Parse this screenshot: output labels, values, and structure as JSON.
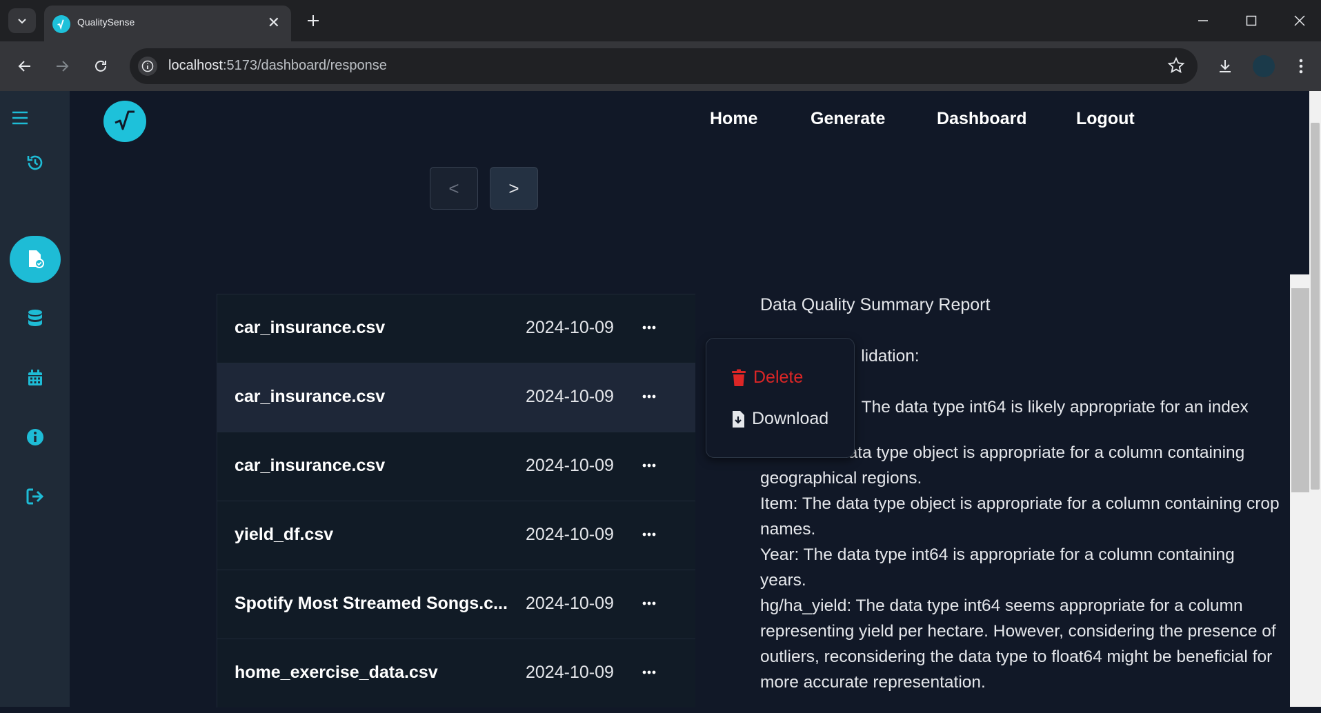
{
  "browser": {
    "tab_title": "QualitySense",
    "url_host": "localhost",
    "url_path": ":5173/dashboard/response"
  },
  "icons": {
    "tab_menu": "chevron-down-icon",
    "favicon": "qualitysense-logo",
    "tab_close": "close-icon",
    "new_tab": "plus-icon",
    "back": "arrow-left-icon",
    "forward": "arrow-right-icon",
    "reload": "reload-icon",
    "site_info": "info-icon",
    "bookmark": "star-icon",
    "downloads": "download-icon",
    "menu": "kebab-icon"
  },
  "sidebar": {
    "items": [
      {
        "name": "history-icon",
        "active": false
      },
      {
        "name": "file-check-icon",
        "active": true
      },
      {
        "name": "database-icon",
        "active": false
      },
      {
        "name": "calendar-icon",
        "active": false
      },
      {
        "name": "info-circle-icon",
        "active": false
      },
      {
        "name": "logout-icon",
        "active": false
      }
    ]
  },
  "nav": {
    "home": "Home",
    "generate": "Generate",
    "dashboard": "Dashboard",
    "logout": "Logout"
  },
  "pager": {
    "prev": "<",
    "next": ">"
  },
  "files": [
    {
      "name": "car_insurance.csv",
      "date": "2024-10-09"
    },
    {
      "name": "car_insurance.csv",
      "date": "2024-10-09"
    },
    {
      "name": "car_insurance.csv",
      "date": "2024-10-09"
    },
    {
      "name": "yield_df.csv",
      "date": "2024-10-09"
    },
    {
      "name": "Spotify Most Streamed Songs.c...",
      "date": "2024-10-09"
    },
    {
      "name": "home_exercise_data.csv",
      "date": "2024-10-09"
    }
  ],
  "popup": {
    "delete": "Delete",
    "download": "Download"
  },
  "report": {
    "title": "Data Quality Summary Report",
    "subtitle_partial": "lidation:",
    "index_partial": "The data type int64 is likely appropriate for an index",
    "lines": [
      "Area: The data type object is appropriate for a column containing geographical regions.",
      "Item: The data type object is appropriate for a column containing crop names.",
      "Year: The data type int64 is appropriate for a column containing years.",
      "hg/ha_yield: The data type int64 seems appropriate for a column representing yield per hectare. However, considering the presence of outliers, reconsidering the data type to float64 might be beneficial for more accurate representation."
    ]
  },
  "colors": {
    "accent": "#1ebcd6",
    "danger": "#dc2626",
    "background": "#111827",
    "sidebar": "#1f2a37"
  }
}
